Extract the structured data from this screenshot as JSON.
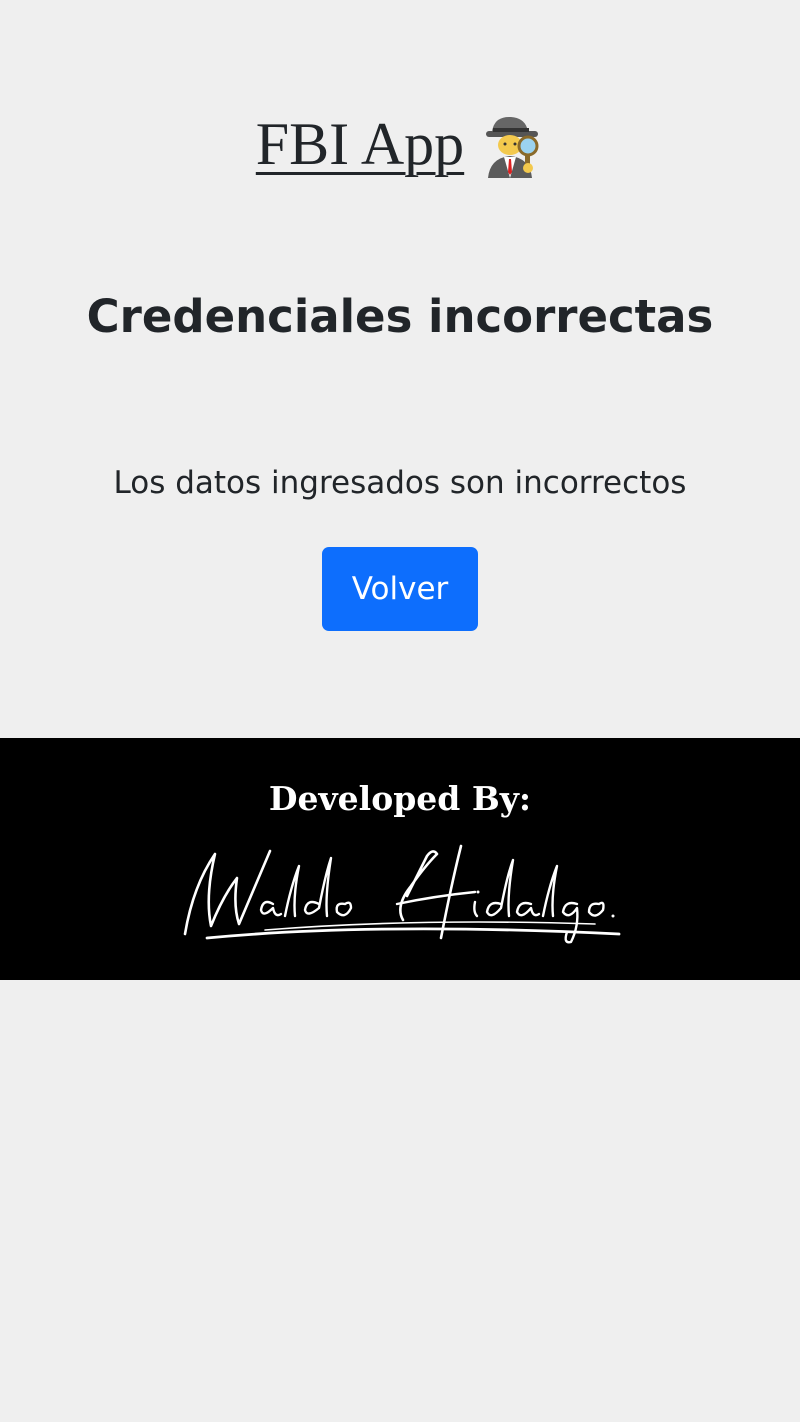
{
  "header": {
    "brand_text": "FBI App",
    "brand_icon": "detective-emoji-icon"
  },
  "main": {
    "title": "Credenciales incorrectas",
    "message": "Los datos ingresados son incorrectos",
    "back_button_label": "Volver"
  },
  "footer": {
    "developed_by_label": "Developed By:",
    "signature_text": "Waldo Hidalgo."
  },
  "colors": {
    "background": "#efefef",
    "button": "#0d6efd",
    "footer": "#000000",
    "text": "#212529"
  }
}
